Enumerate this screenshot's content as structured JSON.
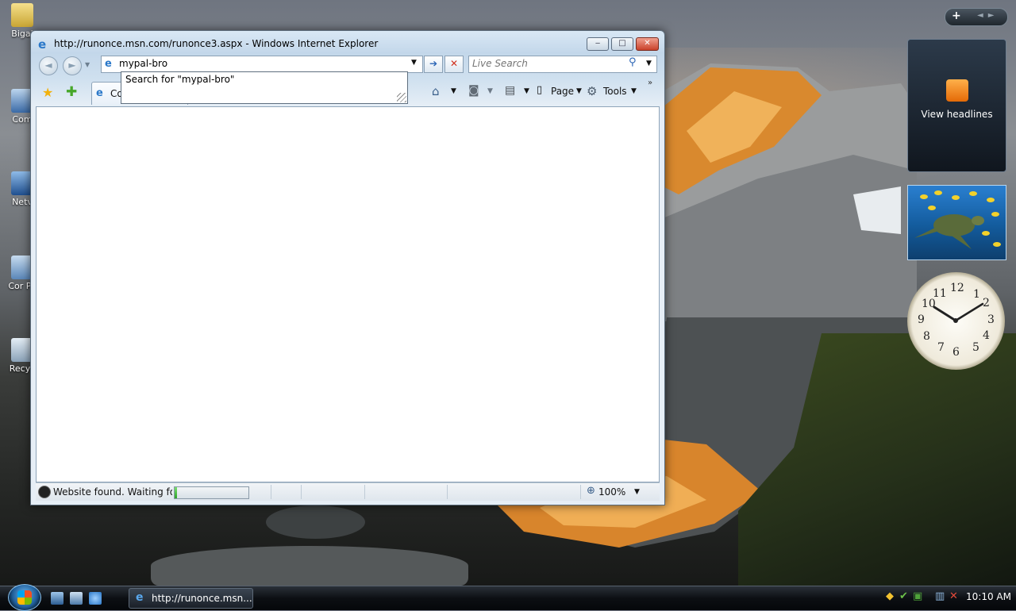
{
  "desktop": {
    "icons": [
      {
        "label": "Bigal"
      },
      {
        "label": "Com"
      },
      {
        "label": "Netv"
      },
      {
        "label": "Cor Pa"
      },
      {
        "label": "Recyc"
      }
    ],
    "gadgets": {
      "feed_label": "View headlines",
      "clock_numbers": [
        "12",
        "1",
        "2",
        "3",
        "4",
        "5",
        "6",
        "7",
        "8",
        "9",
        "10",
        "11"
      ]
    }
  },
  "window": {
    "title": "http://runonce.msn.com/runonce3.aspx - Windows Internet Explorer",
    "controls": {
      "minimize": "‒",
      "maximize": "□",
      "close": "✕"
    },
    "address": {
      "value": "mypal-bro"
    },
    "search": {
      "placeholder": "Live Search"
    },
    "autocomplete": {
      "item": "Search for \"mypal-bro\""
    },
    "tab": {
      "label": "Co"
    },
    "toolbar": {
      "page_label": "Page",
      "tools_label": "Tools"
    },
    "status": {
      "text": "Website found. Waiting for r",
      "progress": 0.03
    },
    "zoom": {
      "label": "100%"
    }
  },
  "taskbar": {
    "ie_button_label": "http://runonce.msn...",
    "clock": "10:10 AM"
  },
  "colors": {
    "accent": "#2a78c9",
    "close": "#c9412a",
    "progress": "#2ea32a"
  }
}
